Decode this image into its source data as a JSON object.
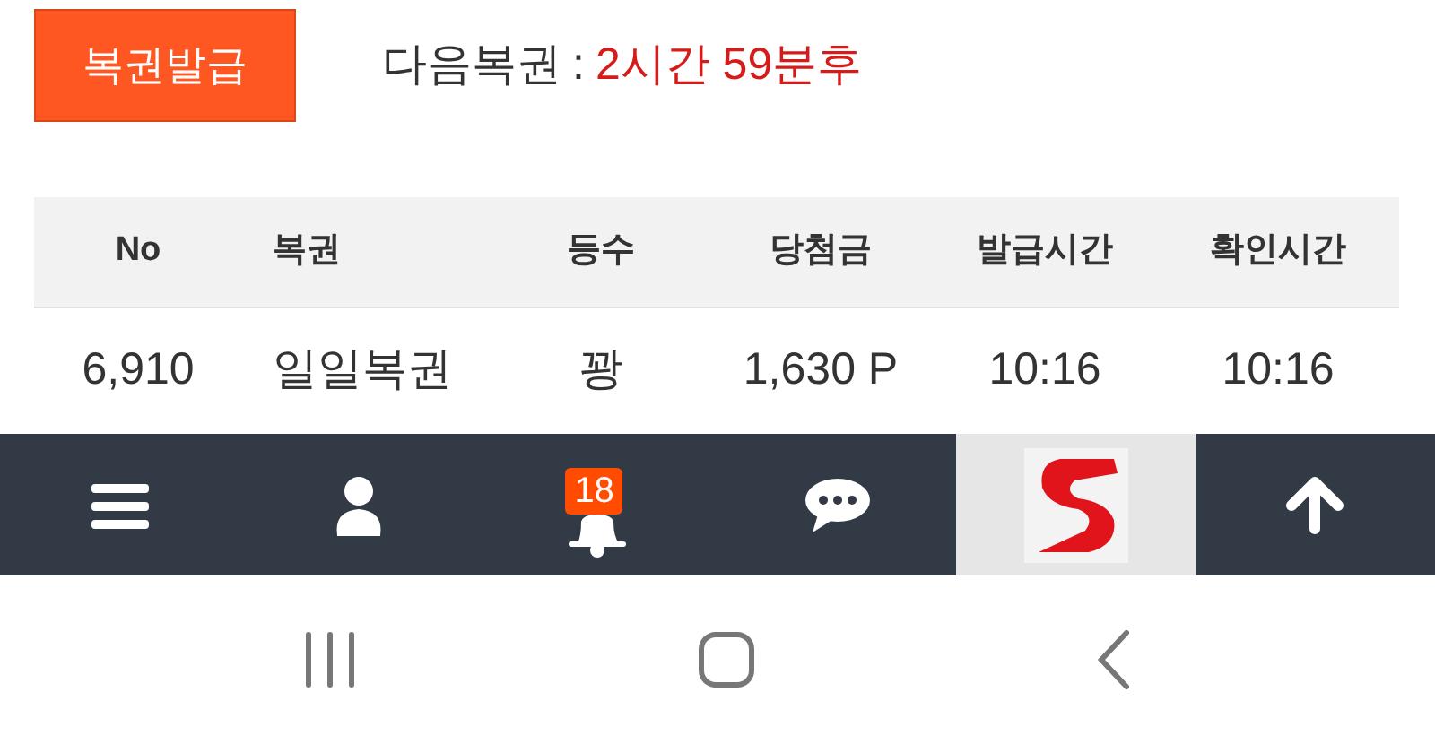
{
  "issue_button": "복권발급",
  "next": {
    "label": "다음복권",
    "separator": ":",
    "value": "2시간 59분후"
  },
  "table": {
    "columns": [
      "No",
      "복권",
      "등수",
      "당첨금",
      "발급시간",
      "확인시간"
    ],
    "rows": [
      [
        "6,910",
        "일일복권",
        "꽝",
        "1,630 P",
        "10:16",
        "10:16"
      ]
    ]
  },
  "bottom_bar": [
    {
      "kind": "menu"
    },
    {
      "kind": "user"
    },
    {
      "kind": "bell",
      "badge": "18"
    },
    {
      "kind": "chat"
    },
    {
      "kind": "logo"
    },
    {
      "kind": "top"
    }
  ]
}
